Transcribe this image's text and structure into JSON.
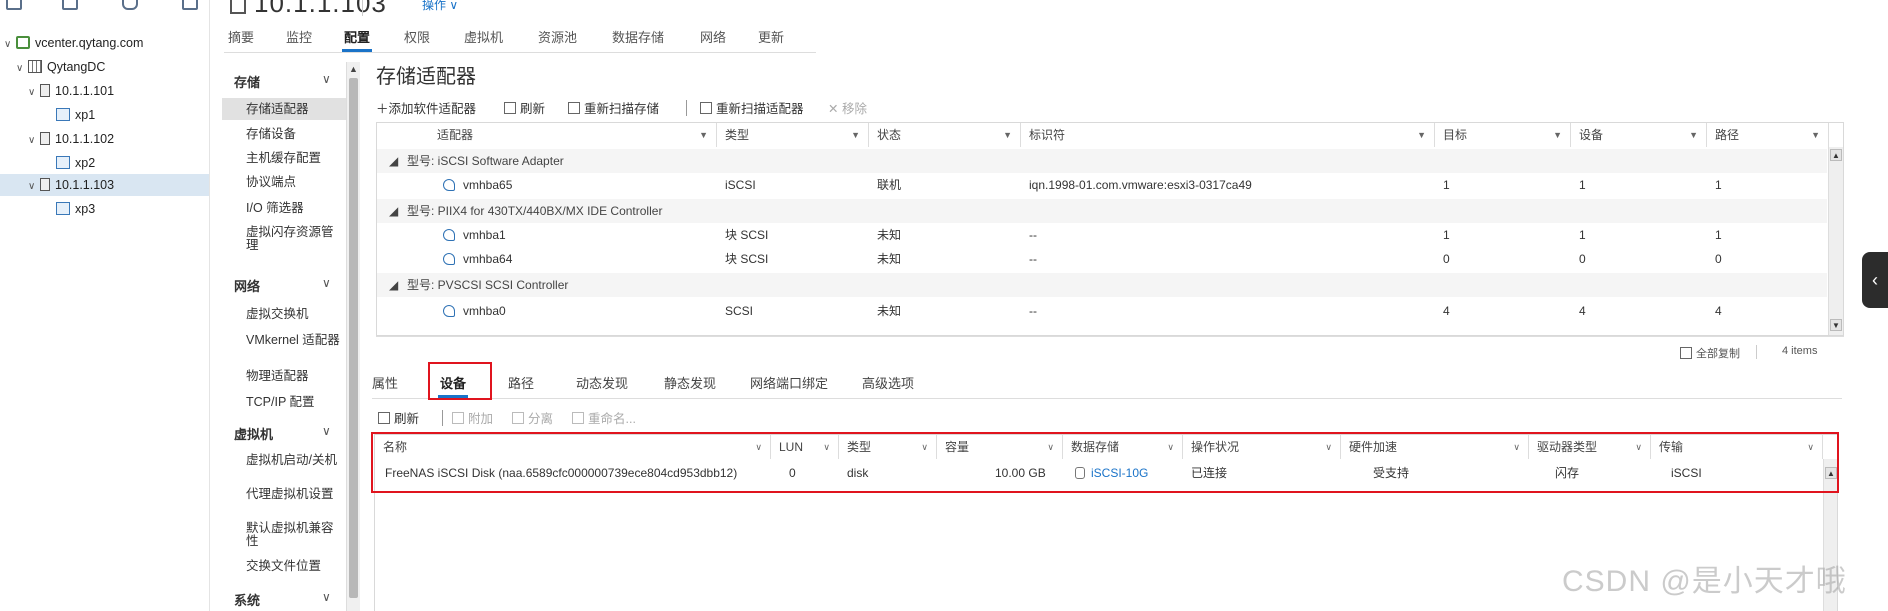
{
  "tree": {
    "items": [
      {
        "label": "vcenter.qytang.com",
        "icon": "vcenter-icon"
      },
      {
        "label": "QytangDC",
        "icon": "datacenter-icon"
      },
      {
        "label": "10.1.1.101",
        "icon": "host-icon"
      },
      {
        "label": "xp1",
        "icon": "vm-icon"
      },
      {
        "label": "10.1.1.102",
        "icon": "host-icon"
      },
      {
        "label": "xp2",
        "icon": "vm-icon"
      },
      {
        "label": "10.1.1.103",
        "icon": "host-icon"
      },
      {
        "label": "xp3",
        "icon": "vm-icon"
      }
    ]
  },
  "header": {
    "host_title": "10.1.1.103",
    "actions_label": "操作"
  },
  "tabs": [
    {
      "label": "摘要"
    },
    {
      "label": "监控"
    },
    {
      "label": "配置",
      "active": true
    },
    {
      "label": "权限"
    },
    {
      "label": "虚拟机"
    },
    {
      "label": "资源池"
    },
    {
      "label": "数据存储"
    },
    {
      "label": "网络"
    },
    {
      "label": "更新"
    }
  ],
  "config_nav": {
    "groups": [
      {
        "label": "存储",
        "items": [
          "存储适配器",
          "存储设备",
          "主机缓存配置",
          "协议端点",
          "I/O 筛选器",
          "虚拟闪存资源管理"
        ]
      },
      {
        "label": "网络",
        "items": [
          "虚拟交换机",
          "VMkernel 适配器",
          "物理适配器",
          "TCP/IP 配置"
        ]
      },
      {
        "label": "虚拟机",
        "items": [
          "虚拟机启动/关机",
          "代理虚拟机设置",
          "默认虚拟机兼容性",
          "交换文件位置"
        ]
      },
      {
        "label": "系统",
        "items": []
      }
    ],
    "selected": "存储适配器"
  },
  "page": {
    "title": "存储适配器"
  },
  "toolbar1": {
    "add_software_adapter": "添加软件适配器",
    "refresh": "刷新",
    "rescan_storage": "重新扫描存储",
    "rescan_adapter": "重新扫描适配器",
    "remove": "移除"
  },
  "adapters_grid": {
    "columns": [
      "适配器",
      "类型",
      "状态",
      "标识符",
      "目标",
      "设备",
      "路径"
    ],
    "groups": [
      {
        "label": "型号: iSCSI Software Adapter",
        "rows": [
          {
            "adapter": "vmhba65",
            "type": "iSCSI",
            "status": "联机",
            "identifier": "iqn.1998-01.com.vmware:esxi3-0317ca49",
            "targets": "1",
            "devices": "1",
            "paths": "1"
          }
        ]
      },
      {
        "label": "型号: PIIX4 for 430TX/440BX/MX IDE Controller",
        "rows": [
          {
            "adapter": "vmhba1",
            "type": "块 SCSI",
            "status": "未知",
            "identifier": "--",
            "targets": "1",
            "devices": "1",
            "paths": "1"
          },
          {
            "adapter": "vmhba64",
            "type": "块 SCSI",
            "status": "未知",
            "identifier": "--",
            "targets": "0",
            "devices": "0",
            "paths": "0"
          }
        ]
      },
      {
        "label": "型号: PVSCSI SCSI Controller",
        "rows": [
          {
            "adapter": "vmhba0",
            "type": "SCSI",
            "status": "未知",
            "identifier": "--",
            "targets": "4",
            "devices": "4",
            "paths": "4"
          }
        ]
      }
    ],
    "footer": {
      "copy_all": "全部复制",
      "count": "4 items"
    }
  },
  "subtabs": [
    {
      "label": "属性"
    },
    {
      "label": "设备",
      "active": true
    },
    {
      "label": "路径"
    },
    {
      "label": "动态发现"
    },
    {
      "label": "静态发现"
    },
    {
      "label": "网络端口绑定"
    },
    {
      "label": "高级选项"
    }
  ],
  "toolbar2": {
    "refresh": "刷新",
    "attach": "附加",
    "detach": "分离",
    "rename": "重命名..."
  },
  "devices_grid": {
    "columns": [
      "名称",
      "LUN",
      "类型",
      "容量",
      "数据存储",
      "操作状况",
      "硬件加速",
      "驱动器类型",
      "传输"
    ],
    "rows": [
      {
        "name": "FreeNAS iSCSI Disk (naa.6589cfc000000739ece804cd953dbb12)",
        "lun": "0",
        "type": "disk",
        "capacity": "10.00 GB",
        "datastore": "iSCSI-10G",
        "op_state": "已连接",
        "hw_accel": "受支持",
        "drive_type": "闪存",
        "transport": "iSCSI"
      }
    ]
  },
  "watermark": "CSDN @是小天才哦",
  "colors": {
    "accent": "#1a73c8",
    "highlight_box": "#e0141e",
    "selected_row": "#d9e6f2"
  }
}
